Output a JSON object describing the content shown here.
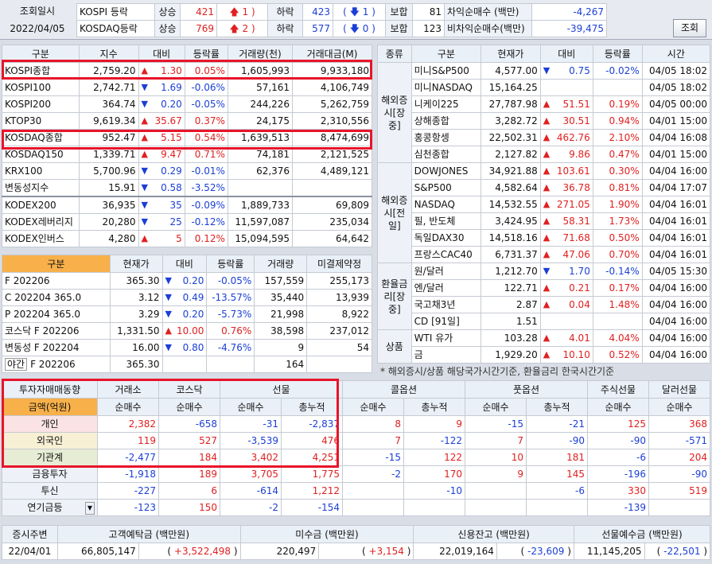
{
  "top": {
    "lbl_query": "조회일시",
    "date": "2022/04/05",
    "button": "조회",
    "rows": [
      {
        "name": "KOSPI 등락",
        "up_lbl": "상승",
        "up": "421",
        "up2": "1",
        "down_lbl": "하락",
        "down": "423",
        "down2": "1",
        "hold_lbl": "보합",
        "hold": "81",
        "prog_lbl": "차익순매수 (백만)",
        "prog": "-4,267"
      },
      {
        "name": "KOSDAQ등락",
        "up_lbl": "상승",
        "up": "769",
        "up2": "2",
        "down_lbl": "하락",
        "down": "577",
        "down2": "0",
        "hold_lbl": "보합",
        "hold": "123",
        "prog_lbl": "비차익순매수(백만)",
        "prog": "-39,475"
      }
    ]
  },
  "idx": {
    "headers": [
      "구분",
      "지수",
      "대비",
      "등락률",
      "거래량(천)",
      "거래대금(M)"
    ],
    "rows": [
      [
        "KOSPI종합",
        "2,759.20",
        "up",
        "1.30",
        "0.05%",
        "1,605,993",
        "9,933,180"
      ],
      [
        "KOSPI100",
        "2,742.71",
        "dn",
        "1.69",
        "-0.06%",
        "57,161",
        "4,106,749"
      ],
      [
        "KOSPI200",
        "364.74",
        "dn",
        "0.20",
        "-0.05%",
        "244,226",
        "5,262,759"
      ],
      [
        "KTOP30",
        "9,619.34",
        "up",
        "35.67",
        "0.37%",
        "24,175",
        "2,310,556"
      ],
      [
        "KOSDAQ종합",
        "952.47",
        "up",
        "5.15",
        "0.54%",
        "1,639,513",
        "8,474,699"
      ],
      [
        "KOSDAQ150",
        "1,339.71",
        "up",
        "9.47",
        "0.71%",
        "74,181",
        "2,121,525"
      ],
      [
        "KRX100",
        "5,700.96",
        "dn",
        "0.29",
        "-0.01%",
        "62,376",
        "4,489,121"
      ],
      [
        "변동성지수",
        "15.91",
        "dn",
        "0.58",
        "-3.52%",
        "",
        ""
      ],
      [
        "KODEX200",
        "36,935",
        "dn",
        "35",
        "-0.09%",
        "1,889,733",
        "69,809"
      ],
      [
        "KODEX레버리지",
        "20,280",
        "dn",
        "25",
        "-0.12%",
        "11,597,087",
        "235,034"
      ],
      [
        "KODEX인버스",
        "4,280",
        "up",
        "5",
        "0.12%",
        "15,094,595",
        "64,642"
      ]
    ]
  },
  "fut": {
    "headers": [
      "구분",
      "현재가",
      "대비",
      "등락률",
      "거래량",
      "미결제약정"
    ],
    "rows": [
      [
        "F 202206",
        "365.30",
        "dn",
        "0.20",
        "-0.05%",
        "157,559",
        "255,173"
      ],
      [
        "C 202204 365.0",
        "3.12",
        "dn",
        "0.49",
        "-13.57%",
        "35,440",
        "13,939"
      ],
      [
        "P 202204 365.0",
        "3.29",
        "dn",
        "0.20",
        "-5.73%",
        "21,998",
        "8,922"
      ],
      [
        "코스닥 F 202206",
        "1,331.50",
        "up",
        "10.00",
        "0.76%",
        "38,598",
        "237,012"
      ],
      [
        "변동성 F 202204",
        "16.00",
        "dn",
        "0.80",
        "-4.76%",
        "9",
        "54"
      ]
    ],
    "night_lbl": "야간",
    "night_name": "F 202206",
    "night_price": "365.30",
    "night_vol": "164"
  },
  "world": {
    "headers": [
      "종류",
      "구분",
      "현재가",
      "대비",
      "등락률",
      "시간"
    ],
    "groups": [
      {
        "label": "해외증시[장중]"
      },
      {
        "label": "해외증시[전일]"
      },
      {
        "label": "환율금리[장중]"
      },
      {
        "label": "상품"
      }
    ],
    "rows": [
      [
        "미니S&P500",
        "4,577.00",
        "dn",
        "0.75",
        "-0.02%",
        "04/05 18:02"
      ],
      [
        "미니NASDAQ",
        "15,164.25",
        "",
        "",
        "",
        "04/05 18:02"
      ],
      [
        "니케이225",
        "27,787.98",
        "up",
        "51.51",
        "0.19%",
        "04/05 00:00"
      ],
      [
        "상해종합",
        "3,282.72",
        "up",
        "30.51",
        "0.94%",
        "04/01 15:00"
      ],
      [
        "홍콩항셍",
        "22,502.31",
        "up",
        "462.76",
        "2.10%",
        "04/04 16:08"
      ],
      [
        "심천종합",
        "2,127.82",
        "up",
        "9.86",
        "0.47%",
        "04/01 15:00"
      ],
      [
        "DOWJONES",
        "34,921.88",
        "up",
        "103.61",
        "0.30%",
        "04/04 16:00"
      ],
      [
        "S&P500",
        "4,582.64",
        "up",
        "36.78",
        "0.81%",
        "04/04 17:07"
      ],
      [
        "NASDAQ",
        "14,532.55",
        "up",
        "271.05",
        "1.90%",
        "04/04 16:01"
      ],
      [
        "필, 반도체",
        "3,424.95",
        "up",
        "58.31",
        "1.73%",
        "04/04 16:01"
      ],
      [
        "독일DAX30",
        "14,518.16",
        "up",
        "71.68",
        "0.50%",
        "04/04 16:01"
      ],
      [
        "프랑스CAC40",
        "6,731.37",
        "up",
        "47.06",
        "0.70%",
        "04/04 16:01"
      ],
      [
        "원/달러",
        "1,212.70",
        "dn",
        "1.70",
        "-0.14%",
        "04/05 15:30"
      ],
      [
        "엔/달러",
        "122.71",
        "up",
        "0.21",
        "0.17%",
        "04/04 16:00"
      ],
      [
        "국고채3년",
        "2.87",
        "up",
        "0.04",
        "1.48%",
        "04/04 16:00"
      ],
      [
        "CD [91일]",
        "1.51",
        "",
        "",
        "",
        "04/04 16:00"
      ],
      [
        "WTI 유가",
        "103.28",
        "up",
        "4.01",
        "4.04%",
        "04/04 16:00"
      ],
      [
        "금",
        "1,929.20",
        "up",
        "10.10",
        "0.52%",
        "04/04 16:00"
      ]
    ],
    "note": "* 해외증시/상품 해당국가시간기준, 환율금리 한국시간기준"
  },
  "inv": {
    "title": "투자자매매동향",
    "unit": "금액(억원)",
    "h1": [
      "거래소",
      "코스닥",
      "선물",
      "콜옵션",
      "풋옵션",
      "주식선물",
      "달러선물"
    ],
    "h2": [
      "순매수",
      "순매수",
      "순매수",
      "총누적",
      "순매수",
      "총누적",
      "순매수",
      "총누적",
      "순매수",
      "순매수"
    ],
    "rows": [
      {
        "name": "개인",
        "v": [
          "2,382",
          "-658",
          "-31",
          "-2,837",
          "8",
          "9",
          "-15",
          "-21",
          "125",
          "368"
        ]
      },
      {
        "name": "외국인",
        "v": [
          "119",
          "527",
          "-3,539",
          "476",
          "7",
          "-122",
          "7",
          "-90",
          "-90",
          "-571"
        ]
      },
      {
        "name": "기관계",
        "v": [
          "-2,477",
          "184",
          "3,402",
          "4,251",
          "-15",
          "122",
          "10",
          "181",
          "-6",
          "204"
        ]
      },
      {
        "name": "금융투자",
        "v": [
          "-1,918",
          "189",
          "3,705",
          "1,775",
          "-2",
          "170",
          "9",
          "145",
          "-196",
          "-90"
        ]
      },
      {
        "name": "투신",
        "v": [
          "-227",
          "6",
          "-614",
          "1,212",
          "",
          "-10",
          "",
          "-6",
          "330",
          "519"
        ]
      },
      {
        "name": "연기금등",
        "v": [
          "-123",
          "150",
          "-2",
          "-154",
          "",
          "",
          "",
          "",
          "-139",
          ""
        ]
      }
    ]
  },
  "bottom": {
    "headers": [
      "증시주변",
      "고객예탁금 (백만원)",
      "미수금 (백만원)",
      "신용잔고 (백만원)",
      "선물예수금 (백만원)"
    ],
    "date": "22/04/01",
    "v1": "66,805,147",
    "d1": "+3,522,498",
    "v2": "220,497",
    "d2": "+3,154",
    "v3": "22,019,164",
    "d3": "-23,609",
    "v4": "11,145,205",
    "d4": "-22,501"
  }
}
